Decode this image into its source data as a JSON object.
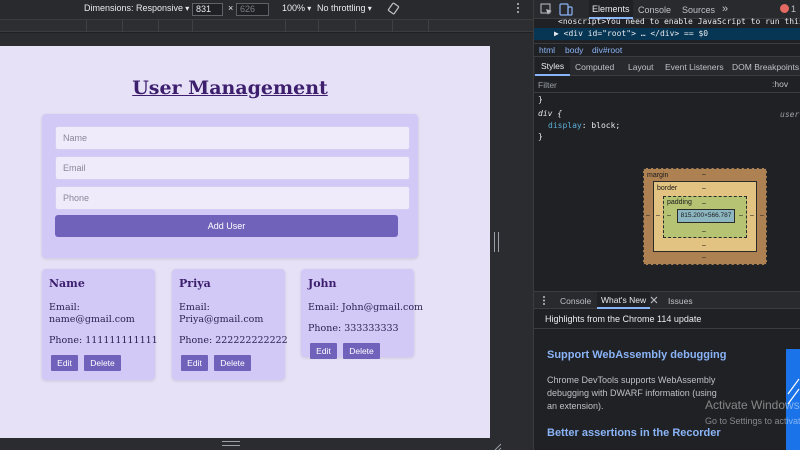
{
  "device_toolbar": {
    "dimensions_label": "Dimensions: Responsive",
    "width_value": "831",
    "times": "×",
    "height_value": "626",
    "zoom_label": "100%",
    "throttle_label": "No throttling"
  },
  "app": {
    "title": "User Management",
    "form": {
      "name_placeholder": "Name",
      "email_placeholder": "Email",
      "phone_placeholder": "Phone",
      "submit_label": "Add User"
    },
    "users": [
      {
        "name": "Name",
        "email_line1": "Email:",
        "email_line2": "name@gmail.com",
        "phone": "Phone: 111111111111",
        "edit_label": "Edit",
        "delete_label": "Delete"
      },
      {
        "name": "Priya",
        "email_line1": "Email:",
        "email_line2": "Priya@gmail.com",
        "phone": "Phone: 222222222222",
        "edit_label": "Edit",
        "delete_label": "Delete"
      },
      {
        "name": "John",
        "email_line1": "Email: John@gmail.com",
        "email_line2": "",
        "phone": "Phone: 333333333",
        "edit_label": "Edit",
        "delete_label": "Delete"
      }
    ]
  },
  "devtools": {
    "tabs": {
      "elements": "Elements",
      "console": "Console",
      "sources": "Sources",
      "more": "»",
      "error_count": "1"
    },
    "dom": {
      "noscript_line": "<noscript>You need to enable JavaScript to run this a",
      "root_line": "▶ <div id=\"root\"> … </div> == $0"
    },
    "breadcrumbs": [
      "html",
      "body",
      "div#root"
    ],
    "styles_tabs": [
      "Styles",
      "Computed",
      "Layout",
      "Event Listeners",
      "DOM Breakpoints"
    ],
    "filter_placeholder": "Filter",
    "filter_hov": ":hov",
    "css": {
      "close_brace_prev": "}",
      "selector": "div {",
      "source": "user",
      "property": "display",
      "value": ": block;",
      "close_brace": "}"
    },
    "box_model": {
      "margin_label": "margin",
      "border_label": "border",
      "padding_label": "padding",
      "content_size": "815.200×566.787",
      "dash": "–"
    },
    "drawer": {
      "tabs": [
        "Console",
        "What's New",
        "Issues"
      ],
      "highlight": "Highlights from the Chrome 114 update",
      "heading1": "Support WebAssembly debugging",
      "body1": "Chrome DevTools supports WebAssembly debugging with DWARF information (using an extension).",
      "heading2": "Better assertions in the Recorder"
    },
    "watermark": {
      "title": "Activate Windows",
      "subtitle": "Go to Settings to activate Windows."
    }
  }
}
